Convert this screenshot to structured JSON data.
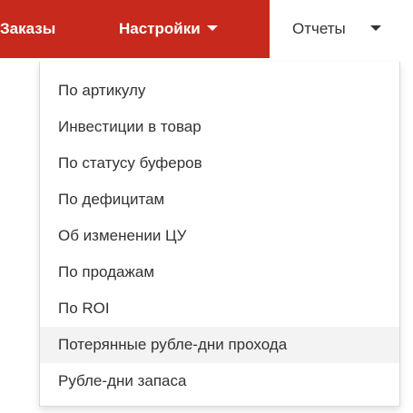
{
  "navbar": {
    "background_color": "#c8291d",
    "items": [
      {
        "label": "Заказы"
      },
      {
        "label": "Настройки"
      },
      {
        "label": "Отчеты"
      }
    ]
  },
  "reports_menu": {
    "items": [
      {
        "label": "По артикулу"
      },
      {
        "label": "Инвестиции в товар"
      },
      {
        "label": "По статусу буферов"
      },
      {
        "label": "По дефицитам"
      },
      {
        "label": "Об изменении ЦУ"
      },
      {
        "label": "По продажам"
      },
      {
        "label": "По ROI"
      },
      {
        "label": "Потерянные рубле-дни прохода"
      },
      {
        "label": "Рубле-дни запаса"
      }
    ],
    "highlighted_index": 7,
    "highlight_color": "#f3f3f3"
  },
  "icons": {
    "settings_caret": "caret-down-icon",
    "reports_caret": "caret-down-icon"
  }
}
